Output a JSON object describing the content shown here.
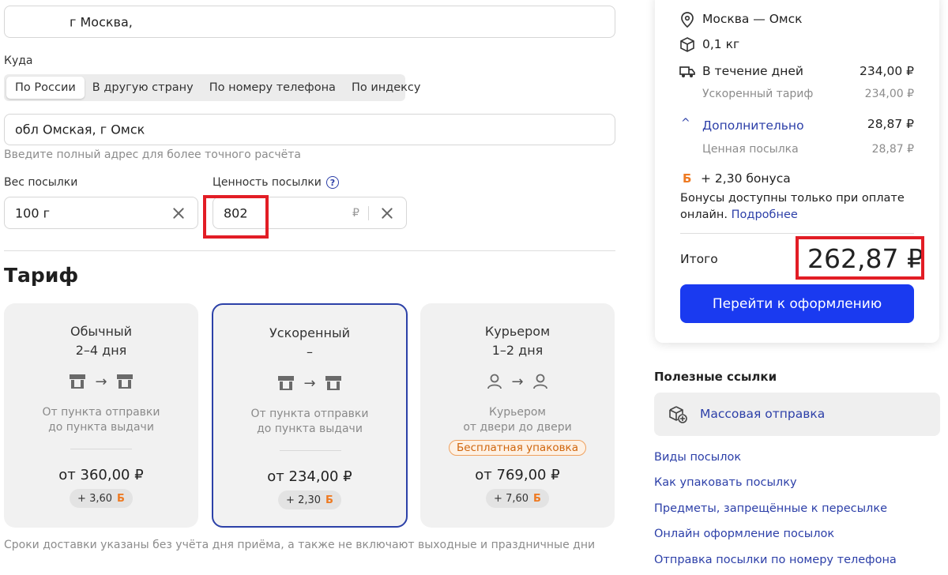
{
  "from": {
    "address_value": "г Москва,"
  },
  "to": {
    "label": "Куда",
    "tabs": [
      "По России",
      "В другую страну",
      "По номеру телефона",
      "По индексу"
    ],
    "address_value": "обл Омская, г Омск",
    "hint": "Введите полный адрес для более точного расчёта"
  },
  "weight": {
    "label": "Вес посылки",
    "value": "100 г"
  },
  "value": {
    "label": "Ценность посылки",
    "help_glyph": "?",
    "value": "802",
    "currency": "₽"
  },
  "tariff": {
    "title": "Тариф",
    "bonus_glyph": "Б",
    "cards": [
      {
        "name": "Обычный",
        "days": "2–4 дня",
        "desc1": "От пункта отправки",
        "desc2": "до пункта выдачи",
        "price": "от 360,00 ₽",
        "bonus": "+ 3,60"
      },
      {
        "name": "Ускоренный",
        "days": "–",
        "desc1": "От пункта отправки",
        "desc2": "до пункта выдачи",
        "price": "от 234,00 ₽",
        "bonus": "+ 2,30"
      },
      {
        "name": "Курьером",
        "days": "1–2 дня",
        "desc1": "Курьером",
        "desc2": "от двери до двери",
        "badge": "Бесплатная упаковка",
        "price": "от 769,00 ₽",
        "bonus": "+ 7,60"
      }
    ],
    "footnote": "Сроки доставки указаны без учёта дня приёма, а также не включают выходные и праздничные дни"
  },
  "summary": {
    "route": "Москва — Омск",
    "weight": "0,1 кг",
    "delivery_label": "В течение дней",
    "delivery_price": "234,00 ₽",
    "tariff_label": "Ускоренный тариф",
    "tariff_price": "234,00 ₽",
    "extra_label": "Дополнительно",
    "extra_price": "28,87 ₽",
    "valuable_label": "Ценная посылка",
    "valuable_price": "28,87 ₽",
    "bonus_line": "+ 2,30 бонуса",
    "bonus_note_1": "Бонусы доступны только при оплате",
    "bonus_note_2": "онлайн.",
    "bonus_more": "Подробнее",
    "total_label": "Итого",
    "total_value": "262,87 ₽",
    "checkout_button": "Перейти к оформлению"
  },
  "useful": {
    "title": "Полезные ссылки",
    "mass_send": "Массовая отправка",
    "links": [
      "Виды посылок",
      "Как упаковать посылку",
      "Предметы, запрещённые к пересылке",
      "Онлайн оформление посылок",
      "Отправка посылки по номеру телефона"
    ]
  },
  "colors": {
    "accent": "#1a3af0",
    "link": "#2c3fa8",
    "bonus": "#ee7a22",
    "highlight": "#e21d25"
  }
}
